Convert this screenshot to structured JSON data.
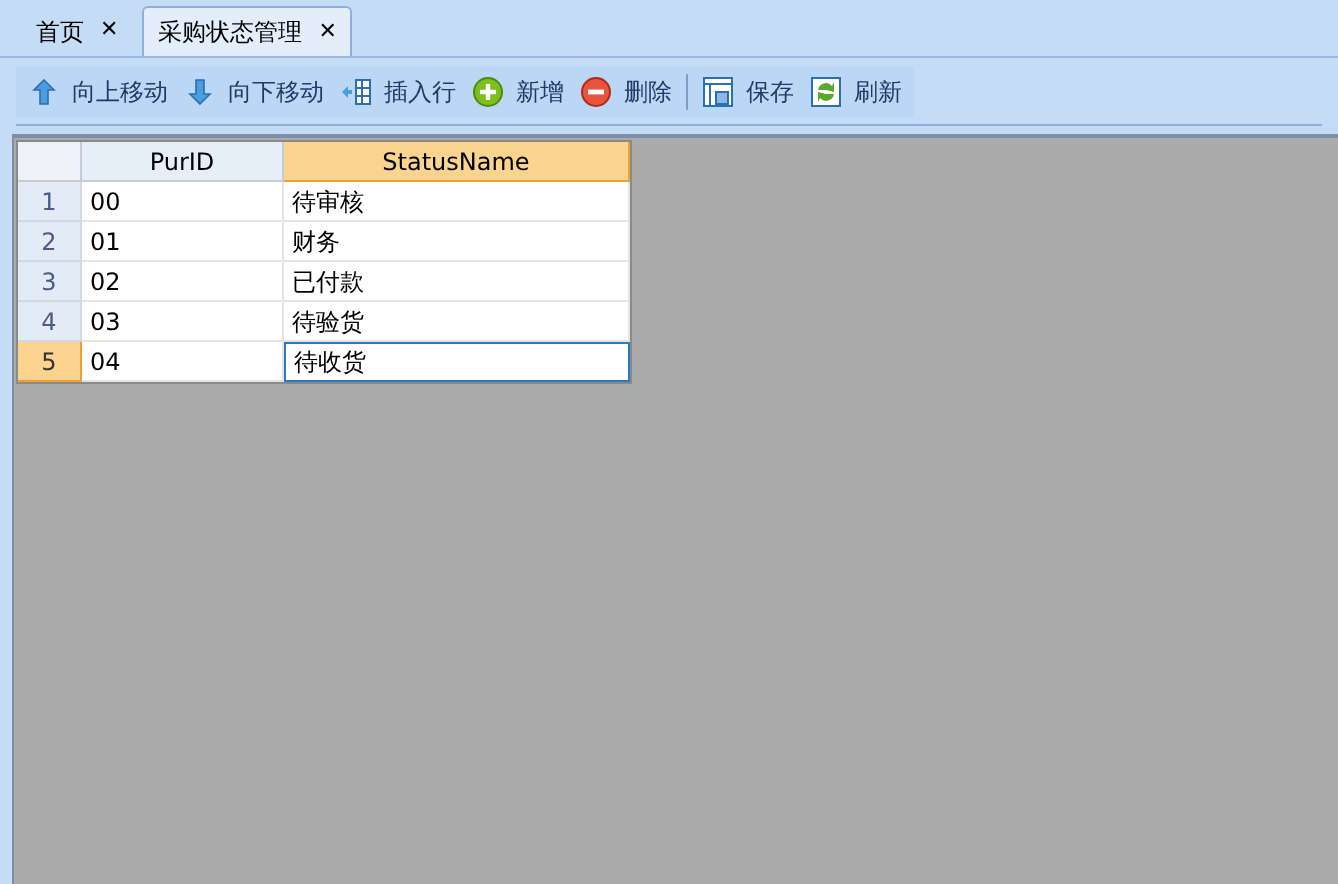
{
  "tabs": [
    {
      "label": "首页",
      "close": "✕",
      "selected": false
    },
    {
      "label": "采购状态管理",
      "close": "✕",
      "selected": true
    }
  ],
  "toolbar": [
    {
      "label": "向上移动",
      "kind": "up"
    },
    {
      "label": "向下移动",
      "kind": "down"
    },
    {
      "label": "插入行",
      "kind": "insert"
    },
    {
      "label": "新增",
      "kind": "add"
    },
    {
      "label": "删除",
      "kind": "delete"
    },
    {
      "kind": "separator"
    },
    {
      "label": "保存",
      "kind": "save"
    },
    {
      "label": "刷新",
      "kind": "refresh"
    }
  ],
  "table": {
    "columns": [
      {
        "label": "PurID",
        "selected": false
      },
      {
        "label": "StatusName",
        "selected": true
      }
    ],
    "rows": [
      {
        "number": "1",
        "cells": [
          "00",
          "待审核"
        ],
        "selected": false
      },
      {
        "number": "2",
        "cells": [
          "01",
          "财务"
        ],
        "selected": false
      },
      {
        "number": "3",
        "cells": [
          "02",
          "已付款"
        ],
        "selected": false
      },
      {
        "number": "4",
        "cells": [
          "03",
          "待验货"
        ],
        "selected": false
      },
      {
        "number": "5",
        "cells": [
          "04",
          "待收货"
        ],
        "selected": true
      }
    ]
  }
}
